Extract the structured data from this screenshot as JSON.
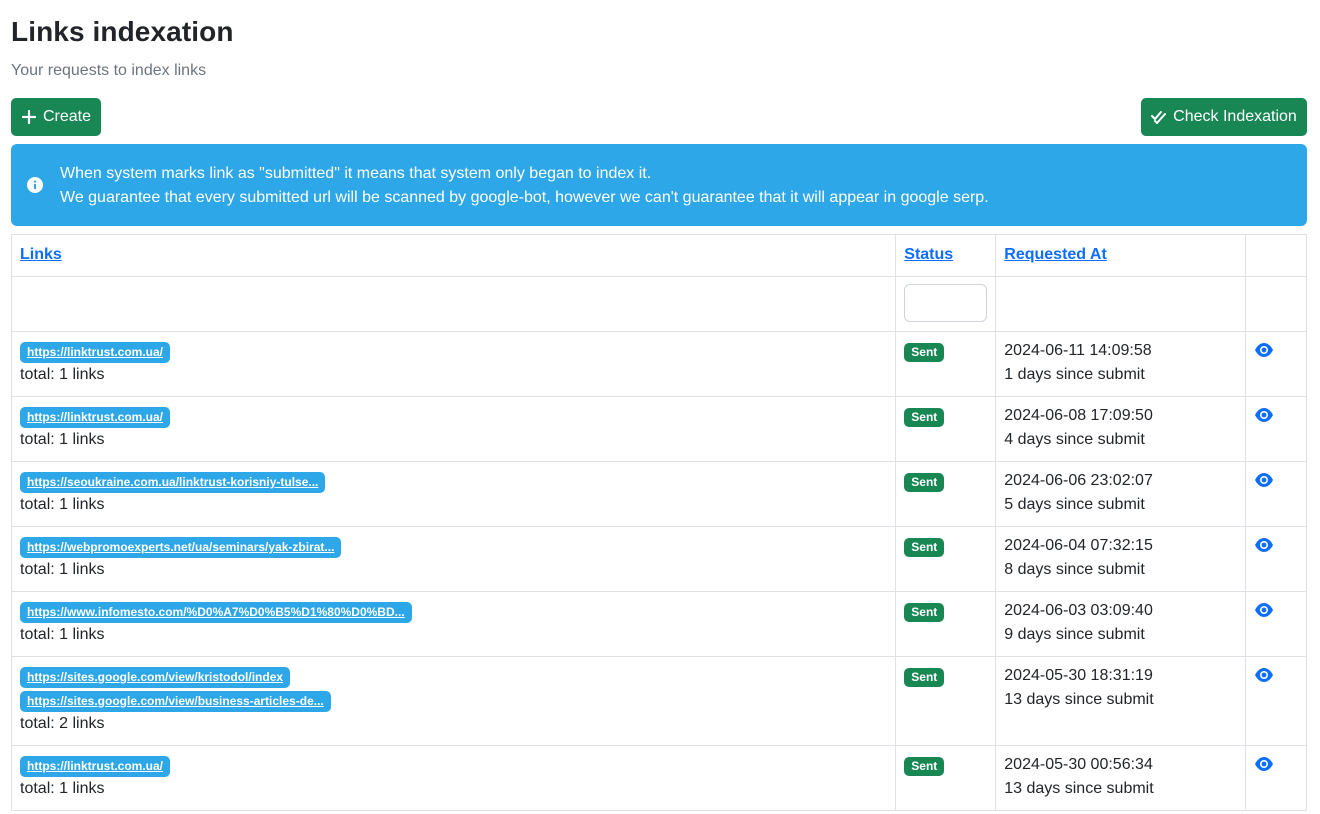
{
  "header": {
    "title": "Links indexation",
    "subtitle": "Your requests to index links"
  },
  "toolbar": {
    "create_label": "Create",
    "check_label": "Check Indexation"
  },
  "alert": {
    "line1": "When system marks link as \"submitted\" it means that system only began to index it.",
    "line2": "We guarantee that every submitted url will be scanned by google-bot, however we can't guarantee that it will appear in google serp."
  },
  "table": {
    "headers": {
      "links": "Links",
      "status": "Status",
      "requested_at": "Requested At"
    },
    "rows": [
      {
        "links": [
          "https://linktrust.com.ua/"
        ],
        "total": "total: 1 links",
        "status": "Sent",
        "date": "2024-06-11 14:09:58",
        "since": "1 days since submit"
      },
      {
        "links": [
          "https://linktrust.com.ua/"
        ],
        "total": "total: 1 links",
        "status": "Sent",
        "date": "2024-06-08 17:09:50",
        "since": "4 days since submit"
      },
      {
        "links": [
          "https://seoukraine.com.ua/linktrust-korisniy-tulse..."
        ],
        "total": "total: 1 links",
        "status": "Sent",
        "date": "2024-06-06 23:02:07",
        "since": "5 days since submit"
      },
      {
        "links": [
          "https://webpromoexperts.net/ua/seminars/yak-zbirat..."
        ],
        "total": "total: 1 links",
        "status": "Sent",
        "date": "2024-06-04 07:32:15",
        "since": "8 days since submit"
      },
      {
        "links": [
          "https://www.infomesto.com/%D0%A7%D0%B5%D1%80%D0%BD..."
        ],
        "total": "total: 1 links",
        "status": "Sent",
        "date": "2024-06-03 03:09:40",
        "since": "9 days since submit"
      },
      {
        "links": [
          "https://sites.google.com/view/kristodol/index",
          "https://sites.google.com/view/business-articles-de..."
        ],
        "total": "total: 2 links",
        "status": "Sent",
        "date": "2024-05-30 18:31:19",
        "since": "13 days since submit"
      },
      {
        "links": [
          "https://linktrust.com.ua/"
        ],
        "total": "total: 1 links",
        "status": "Sent",
        "date": "2024-05-30 00:56:34",
        "since": "13 days since submit"
      }
    ]
  },
  "colors": {
    "success": "#198754",
    "info": "#2ea7e8",
    "link": "#0d6efd"
  }
}
